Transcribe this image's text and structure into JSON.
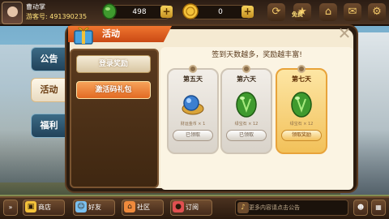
{
  "topbar": {
    "player_name": "曹动掌",
    "player_id": "游客号: 491390235",
    "gems": "498",
    "coins": "0",
    "free_label": "免费",
    "icons": [
      "share-icon",
      "free-icon",
      "star-icon",
      "gift-icon",
      "mail-icon",
      "settings-icon"
    ]
  },
  "side_tabs": [
    "公告",
    "活动",
    "福利"
  ],
  "dialog": {
    "title": "活动",
    "list": [
      "登录奖励",
      "激活码礼包"
    ],
    "banner": "签到天数越多，奖励越丰富!",
    "days": [
      {
        "label": "第五天",
        "item": "财运金币 × 1",
        "button": "已领取"
      },
      {
        "label": "第六天",
        "item": "绿宝石 × 12",
        "button": "已领取"
      },
      {
        "label": "第七天",
        "item": "绿宝石 × 12",
        "button": "领取奖励"
      }
    ]
  },
  "bottombar": {
    "buttons": [
      "商店",
      "好友",
      "社区",
      "订阅"
    ],
    "chat_placeholder": "更多内容请点击公告"
  },
  "colors": {
    "accent": "#e26a23",
    "gem_green": "#3f9a2e",
    "dialog_bg": "#f5ead2"
  }
}
